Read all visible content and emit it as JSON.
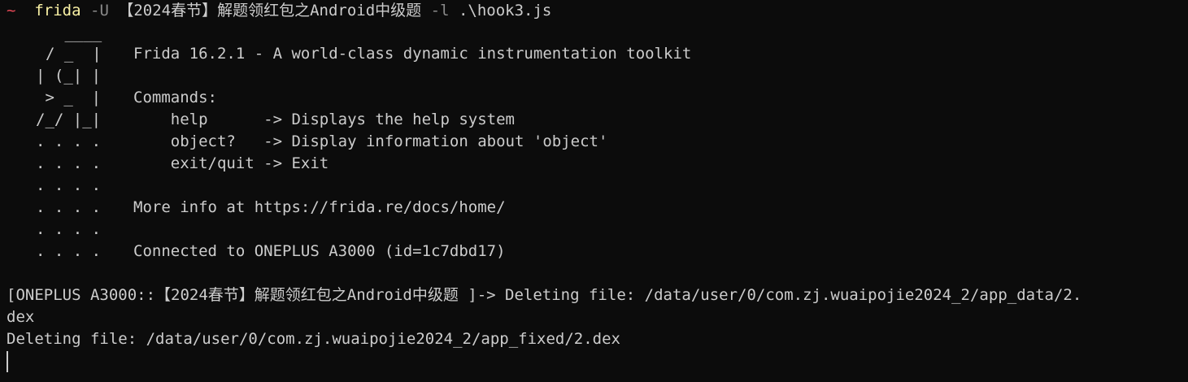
{
  "colors": {
    "background": "#0c0c0c",
    "text": "#cccccc",
    "prompt_arrow": "#e74856",
    "command_name": "#f9f1a5",
    "command_flag": "#8a8a8a"
  },
  "command": {
    "prompt_symbol": "~",
    "program": "frida",
    "flag_device": "-U",
    "target": "【2024春节】解题领红包之Android中级题",
    "flag_load": "-l",
    "script": ".\\hook3.js"
  },
  "banner": {
    "logo": [
      " ____",
      "/ _  |",
      "| (_| |",
      " > _  |",
      "/_/ |_|",
      ". . . .",
      ". . . .",
      ". . . .",
      ". . . .",
      ". . . .",
      ". . . ."
    ],
    "title": "Frida 16.2.1 - A world-class dynamic instrumentation toolkit",
    "commands_heading": "Commands:",
    "commands": [
      "    help      -> Displays the help system",
      "    object?   -> Display information about 'object'",
      "    exit/quit -> Exit"
    ],
    "more_info": "More info at https://frida.re/docs/home/",
    "connected": "Connected to ONEPLUS A3000 (id=1c7dbd17)"
  },
  "output": [
    "[ONEPLUS A3000::【2024春节】解题领红包之Android中级题 ]-> Deleting file: /data/user/0/com.zj.wuaipojie2024_2/app_data/2.",
    "dex",
    "Deleting file: /data/user/0/com.zj.wuaipojie2024_2/app_fixed/2.dex"
  ]
}
